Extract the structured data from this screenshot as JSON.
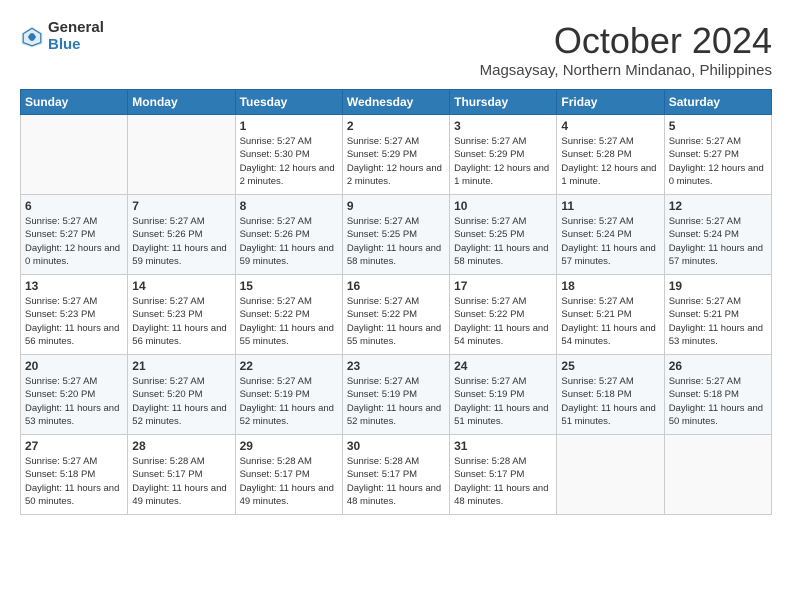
{
  "header": {
    "logo_general": "General",
    "logo_blue": "Blue",
    "month": "October 2024",
    "location": "Magsaysay, Northern Mindanao, Philippines"
  },
  "days_of_week": [
    "Sunday",
    "Monday",
    "Tuesday",
    "Wednesday",
    "Thursday",
    "Friday",
    "Saturday"
  ],
  "weeks": [
    [
      null,
      null,
      {
        "day": 1,
        "sunrise": "5:27 AM",
        "sunset": "5:30 PM",
        "daylight": "12 hours and 2 minutes."
      },
      {
        "day": 2,
        "sunrise": "5:27 AM",
        "sunset": "5:29 PM",
        "daylight": "12 hours and 2 minutes."
      },
      {
        "day": 3,
        "sunrise": "5:27 AM",
        "sunset": "5:29 PM",
        "daylight": "12 hours and 1 minute."
      },
      {
        "day": 4,
        "sunrise": "5:27 AM",
        "sunset": "5:28 PM",
        "daylight": "12 hours and 1 minute."
      },
      {
        "day": 5,
        "sunrise": "5:27 AM",
        "sunset": "5:27 PM",
        "daylight": "12 hours and 0 minutes."
      }
    ],
    [
      {
        "day": 6,
        "sunrise": "5:27 AM",
        "sunset": "5:27 PM",
        "daylight": "12 hours and 0 minutes."
      },
      {
        "day": 7,
        "sunrise": "5:27 AM",
        "sunset": "5:26 PM",
        "daylight": "11 hours and 59 minutes."
      },
      {
        "day": 8,
        "sunrise": "5:27 AM",
        "sunset": "5:26 PM",
        "daylight": "11 hours and 59 minutes."
      },
      {
        "day": 9,
        "sunrise": "5:27 AM",
        "sunset": "5:25 PM",
        "daylight": "11 hours and 58 minutes."
      },
      {
        "day": 10,
        "sunrise": "5:27 AM",
        "sunset": "5:25 PM",
        "daylight": "11 hours and 58 minutes."
      },
      {
        "day": 11,
        "sunrise": "5:27 AM",
        "sunset": "5:24 PM",
        "daylight": "11 hours and 57 minutes."
      },
      {
        "day": 12,
        "sunrise": "5:27 AM",
        "sunset": "5:24 PM",
        "daylight": "11 hours and 57 minutes."
      }
    ],
    [
      {
        "day": 13,
        "sunrise": "5:27 AM",
        "sunset": "5:23 PM",
        "daylight": "11 hours and 56 minutes."
      },
      {
        "day": 14,
        "sunrise": "5:27 AM",
        "sunset": "5:23 PM",
        "daylight": "11 hours and 56 minutes."
      },
      {
        "day": 15,
        "sunrise": "5:27 AM",
        "sunset": "5:22 PM",
        "daylight": "11 hours and 55 minutes."
      },
      {
        "day": 16,
        "sunrise": "5:27 AM",
        "sunset": "5:22 PM",
        "daylight": "11 hours and 55 minutes."
      },
      {
        "day": 17,
        "sunrise": "5:27 AM",
        "sunset": "5:22 PM",
        "daylight": "11 hours and 54 minutes."
      },
      {
        "day": 18,
        "sunrise": "5:27 AM",
        "sunset": "5:21 PM",
        "daylight": "11 hours and 54 minutes."
      },
      {
        "day": 19,
        "sunrise": "5:27 AM",
        "sunset": "5:21 PM",
        "daylight": "11 hours and 53 minutes."
      }
    ],
    [
      {
        "day": 20,
        "sunrise": "5:27 AM",
        "sunset": "5:20 PM",
        "daylight": "11 hours and 53 minutes."
      },
      {
        "day": 21,
        "sunrise": "5:27 AM",
        "sunset": "5:20 PM",
        "daylight": "11 hours and 52 minutes."
      },
      {
        "day": 22,
        "sunrise": "5:27 AM",
        "sunset": "5:19 PM",
        "daylight": "11 hours and 52 minutes."
      },
      {
        "day": 23,
        "sunrise": "5:27 AM",
        "sunset": "5:19 PM",
        "daylight": "11 hours and 52 minutes."
      },
      {
        "day": 24,
        "sunrise": "5:27 AM",
        "sunset": "5:19 PM",
        "daylight": "11 hours and 51 minutes."
      },
      {
        "day": 25,
        "sunrise": "5:27 AM",
        "sunset": "5:18 PM",
        "daylight": "11 hours and 51 minutes."
      },
      {
        "day": 26,
        "sunrise": "5:27 AM",
        "sunset": "5:18 PM",
        "daylight": "11 hours and 50 minutes."
      }
    ],
    [
      {
        "day": 27,
        "sunrise": "5:27 AM",
        "sunset": "5:18 PM",
        "daylight": "11 hours and 50 minutes."
      },
      {
        "day": 28,
        "sunrise": "5:28 AM",
        "sunset": "5:17 PM",
        "daylight": "11 hours and 49 minutes."
      },
      {
        "day": 29,
        "sunrise": "5:28 AM",
        "sunset": "5:17 PM",
        "daylight": "11 hours and 49 minutes."
      },
      {
        "day": 30,
        "sunrise": "5:28 AM",
        "sunset": "5:17 PM",
        "daylight": "11 hours and 48 minutes."
      },
      {
        "day": 31,
        "sunrise": "5:28 AM",
        "sunset": "5:17 PM",
        "daylight": "11 hours and 48 minutes."
      },
      null,
      null
    ]
  ],
  "labels": {
    "sunrise": "Sunrise:",
    "sunset": "Sunset:",
    "daylight": "Daylight:"
  }
}
